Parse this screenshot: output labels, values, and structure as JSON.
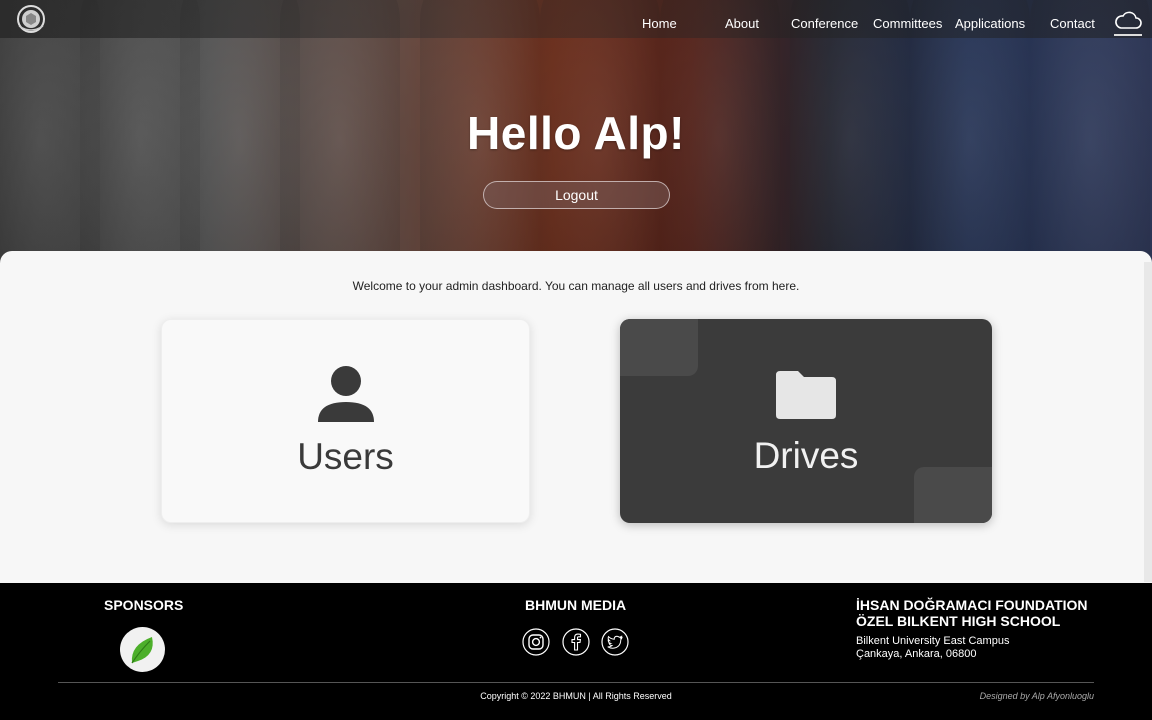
{
  "nav": {
    "items": [
      "Home",
      "About",
      "Conference",
      "Committees",
      "Applications",
      "Contact"
    ]
  },
  "hero": {
    "greeting": "Hello Alp!",
    "logout_label": "Logout"
  },
  "main": {
    "welcome_text": "Welcome to your admin dashboard. You can manage all users and drives from here.",
    "cards": [
      {
        "label": "Users",
        "icon": "user-icon"
      },
      {
        "label": "Drives",
        "icon": "folder-icon"
      }
    ]
  },
  "footer": {
    "sponsors_heading": "SPONSORS",
    "media_heading": "BHMUN MEDIA",
    "social": [
      "instagram-icon",
      "facebook-icon",
      "twitter-icon"
    ],
    "school_line1": "İHSAN DOĞRAMACI FOUNDATION",
    "school_line2": "ÖZEL BILKENT HIGH SCHOOL",
    "address_line1": "Bilkent University East Campus",
    "address_line2": "Çankaya, Ankara, 06800",
    "copyright": "Copyright © 2022 BHMUN | All Rights Reserved",
    "designed_by": "Designed by Alp Afyonluoglu"
  },
  "colors": {
    "panel_bg": "#f7f7f7",
    "drives_card_bg": "#3b3b3b",
    "footer_bg": "#000000"
  }
}
